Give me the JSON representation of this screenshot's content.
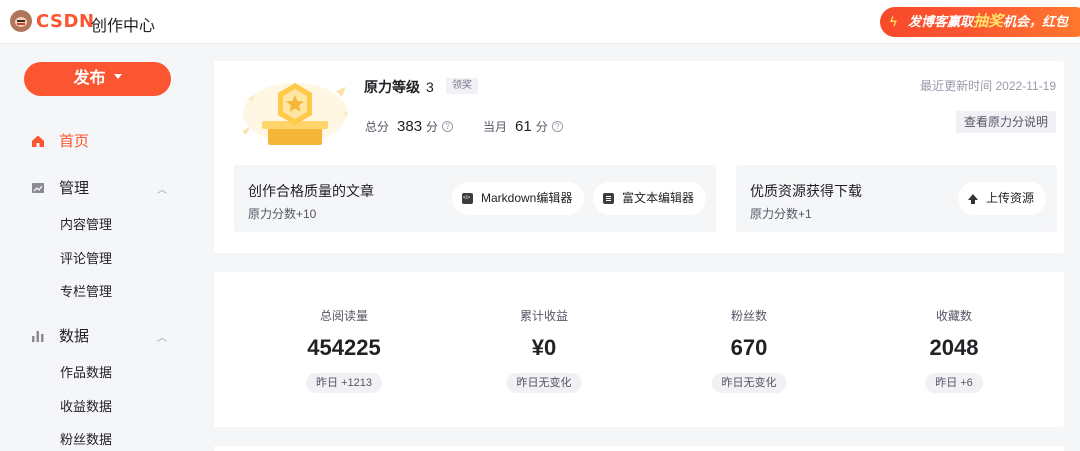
{
  "header": {
    "logo_text": "CSDN",
    "app_title": "创作中心",
    "promo": {
      "prefix": "发博客赢取",
      "highlight": "抽奖",
      "suffix": "机会，红包"
    }
  },
  "sidebar": {
    "publish_label": "发布",
    "items": [
      {
        "label": "首页",
        "icon": "home-icon",
        "active": true
      },
      {
        "label": "管理",
        "icon": "manage-icon",
        "children": [
          "内容管理",
          "评论管理",
          "专栏管理"
        ]
      },
      {
        "label": "数据",
        "icon": "bar-chart-icon",
        "children": [
          "作品数据",
          "收益数据",
          "粉丝数据"
        ]
      }
    ]
  },
  "level": {
    "title": "原力等级",
    "level": "3",
    "claim_badge": "领奖",
    "total_label": "总分",
    "total_value": "383",
    "month_label": "当月",
    "month_value": "61",
    "unit": "分",
    "updated": "最近更新时间 2022-11-19",
    "explain_button": "查看原力分说明"
  },
  "tasks": [
    {
      "title": "创作合格质量的文章",
      "reward": "原力分数+10",
      "buttons": [
        "Markdown编辑器",
        "富文本编辑器"
      ]
    },
    {
      "title": "优质资源获得下载",
      "reward": "原力分数+1",
      "buttons": [
        "上传资源"
      ]
    }
  ],
  "stats": [
    {
      "label": "总阅读量",
      "value": "454225",
      "change": "昨日 +1213"
    },
    {
      "label": "累计收益",
      "value": "¥0",
      "change": "昨日无变化"
    },
    {
      "label": "粉丝数",
      "value": "670",
      "change": "昨日无变化"
    },
    {
      "label": "收藏数",
      "value": "2048",
      "change": "昨日 +6"
    }
  ],
  "colors": {
    "accent": "#fc5531",
    "text": "#222226",
    "muted": "#999aaa"
  }
}
